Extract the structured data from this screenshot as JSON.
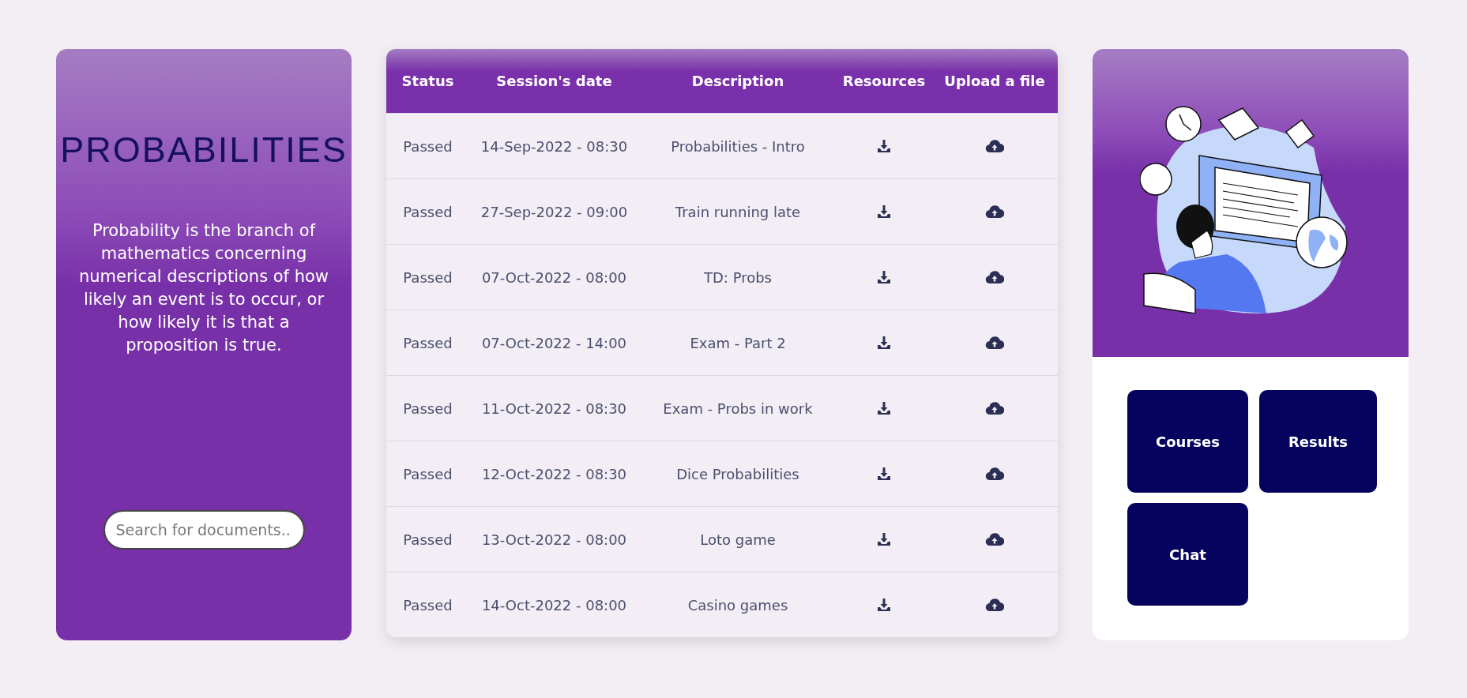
{
  "course": {
    "title": "PROBABILITIES",
    "description": "Probability is the branch of mathematics concerning numerical descriptions of how likely an event is to occur, or how likely it is that a proposition is true.",
    "search": {
      "placeholder": "Search for documents.."
    }
  },
  "table": {
    "columns": [
      "Status",
      "Session's date",
      "Description",
      "Resources",
      "Upload a file"
    ],
    "rows": [
      {
        "status": "Passed",
        "date": "14-Sep-2022 - 08:30",
        "description": "Probabilities - Intro"
      },
      {
        "status": "Passed",
        "date": "27-Sep-2022 - 09:00",
        "description": "Train running late"
      },
      {
        "status": "Passed",
        "date": "07-Oct-2022 - 08:00",
        "description": "TD: Probs"
      },
      {
        "status": "Passed",
        "date": "07-Oct-2022 - 14:00",
        "description": "Exam - Part 2"
      },
      {
        "status": "Passed",
        "date": "11-Oct-2022 - 08:30",
        "description": "Exam - Probs in work"
      },
      {
        "status": "Passed",
        "date": "12-Oct-2022 - 08:30",
        "description": "Dice Probabilities"
      },
      {
        "status": "Passed",
        "date": "13-Oct-2022 - 08:00",
        "description": "Loto game"
      },
      {
        "status": "Passed",
        "date": "14-Oct-2022 - 08:00",
        "description": "Casino games"
      }
    ]
  },
  "nav": [
    "Courses",
    "Results",
    "Chat"
  ]
}
